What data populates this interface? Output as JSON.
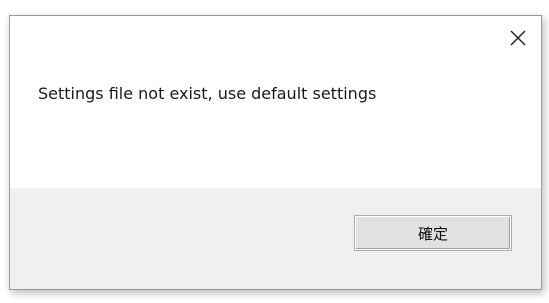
{
  "dialog": {
    "close_icon": "close-icon",
    "message": "Settings file not exist, use default settings",
    "ok_label": "確定"
  },
  "colors": {
    "footer_bg": "#f0f0f0",
    "button_bg": "#e1e1e1",
    "button_border": "#adadad"
  }
}
